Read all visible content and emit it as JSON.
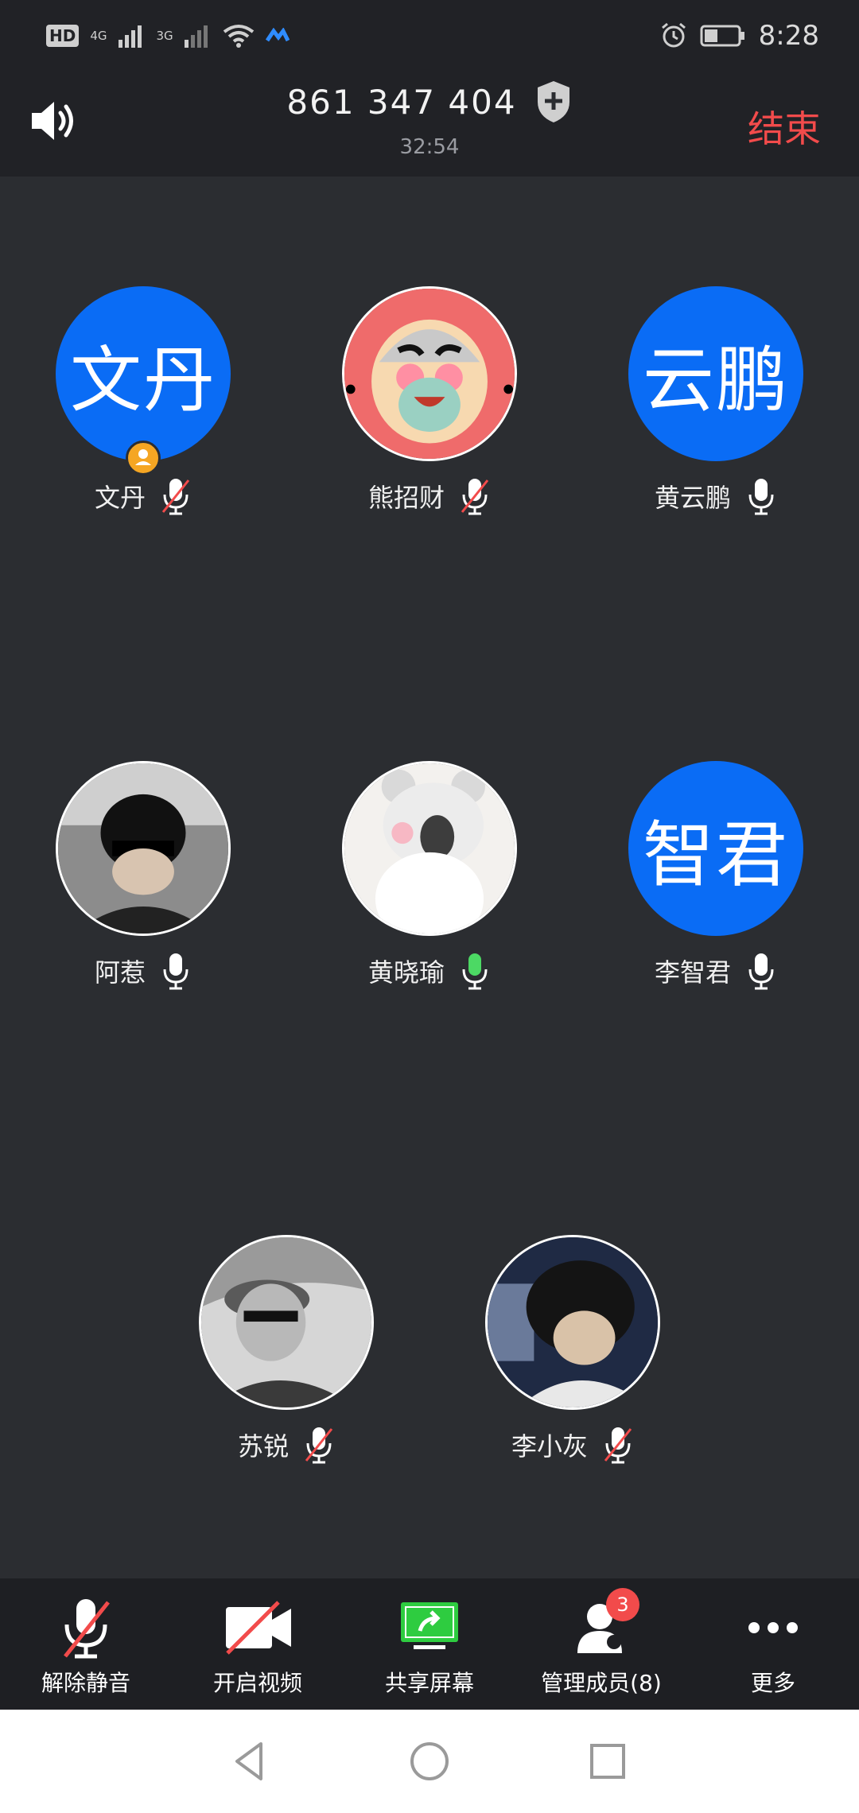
{
  "status_bar": {
    "time": "8:28",
    "hd": "HD",
    "sim1": "1",
    "net1": "4G",
    "net2": "3G",
    "icons": [
      "hd-icon",
      "signal-icon",
      "signal-icon",
      "wifi-icon",
      "app-icon",
      "alarm-icon",
      "battery-icon"
    ]
  },
  "top_bar": {
    "meeting_id": "861 347 404",
    "duration": "32:54",
    "end_label": "结束",
    "end_color": "#f24b4b"
  },
  "participants": [
    {
      "name": "文丹",
      "avatar_text": "文丹",
      "avatar_type": "text",
      "mic": "muted",
      "host": true
    },
    {
      "name": "熊招财",
      "avatar_type": "image",
      "mic": "muted"
    },
    {
      "name": "黄云鹏",
      "avatar_text": "云鹏",
      "avatar_type": "text",
      "mic": "on"
    },
    {
      "name": "阿惹",
      "avatar_type": "image",
      "mic": "on"
    },
    {
      "name": "黄晓瑜",
      "avatar_type": "image",
      "mic": "speaking"
    },
    {
      "name": "李智君",
      "avatar_text": "智君",
      "avatar_type": "text",
      "mic": "on"
    },
    {
      "name": "苏锐",
      "avatar_type": "image",
      "mic": "muted"
    },
    {
      "name": "李小灰",
      "avatar_type": "image",
      "mic": "muted"
    }
  ],
  "toolbar": {
    "unmute_label": "解除静音",
    "video_label": "开启视频",
    "share_label": "共享屏幕",
    "members_label": "管理成员(8)",
    "members_badge": "3",
    "more_label": "更多"
  },
  "colors": {
    "accent_blue": "#0a6cf5",
    "speaking_green": "#4cd964",
    "muted_red": "#f24b4b",
    "share_green": "#2ecc40"
  }
}
